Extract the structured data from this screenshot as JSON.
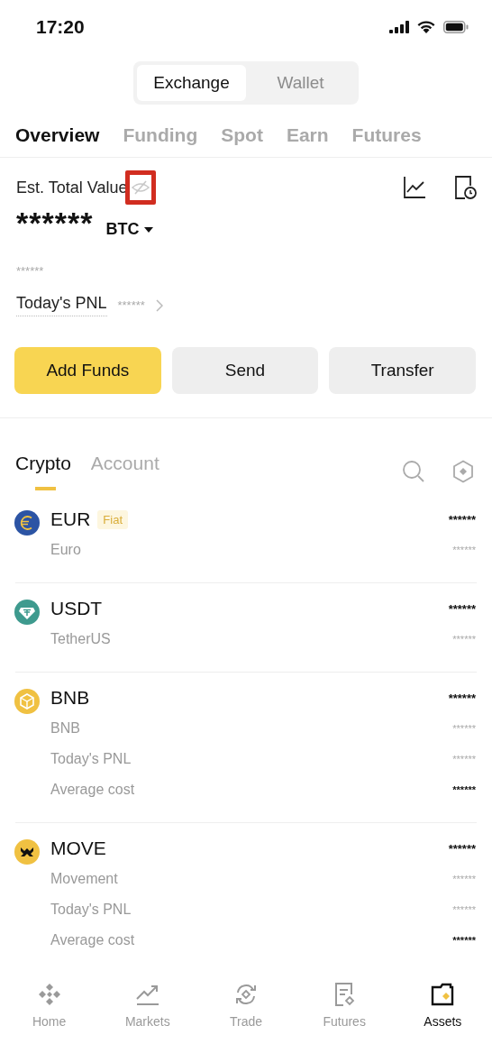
{
  "status_bar": {
    "time": "17:20"
  },
  "mode_switch": [
    {
      "label": "Exchange",
      "selected": true
    },
    {
      "label": "Wallet",
      "selected": false
    }
  ],
  "tabs": [
    {
      "label": "Overview",
      "selected": true
    },
    {
      "label": "Funding",
      "selected": false
    },
    {
      "label": "Spot",
      "selected": false
    },
    {
      "label": "Earn",
      "selected": false
    },
    {
      "label": "Futures",
      "selected": false
    }
  ],
  "summary": {
    "title": "Est. Total Value",
    "balance_hidden": true,
    "highlighted": true,
    "value": "******",
    "currency": "BTC",
    "secondary_value": "******",
    "pnl_label": "Today's PNL",
    "pnl_value": "******"
  },
  "actions": [
    {
      "label": "Add Funds",
      "primary": true
    },
    {
      "label": "Send",
      "primary": false
    },
    {
      "label": "Transfer",
      "primary": false
    }
  ],
  "asset_tabs": [
    {
      "label": "Crypto",
      "selected": true
    },
    {
      "label": "Account",
      "selected": false
    }
  ],
  "assets": [
    {
      "symbol": "EUR",
      "tag": "Fiat",
      "name": "Euro",
      "color": "#2c54a4",
      "amount": "******",
      "value": "******"
    },
    {
      "symbol": "USDT",
      "name": "TetherUS",
      "color": "#3e9a8e",
      "amount": "******",
      "value": "******"
    },
    {
      "symbol": "BNB",
      "name": "BNB",
      "color": "#f0c142",
      "amount": "******",
      "value": "******",
      "details": [
        {
          "label": "Today's PNL",
          "value": "******",
          "strong": false
        },
        {
          "label": "Average cost",
          "value": "******",
          "strong": true
        }
      ]
    },
    {
      "symbol": "MOVE",
      "name": "Movement",
      "color": "#f0c142",
      "amount": "******",
      "value": "******",
      "details": [
        {
          "label": "Today's PNL",
          "value": "******",
          "strong": false
        },
        {
          "label": "Average cost",
          "value": "******",
          "strong": true
        }
      ]
    }
  ],
  "bottom_nav": [
    {
      "label": "Home",
      "selected": false
    },
    {
      "label": "Markets",
      "selected": false
    },
    {
      "label": "Trade",
      "selected": false
    },
    {
      "label": "Futures",
      "selected": false
    },
    {
      "label": "Assets",
      "selected": true
    }
  ]
}
